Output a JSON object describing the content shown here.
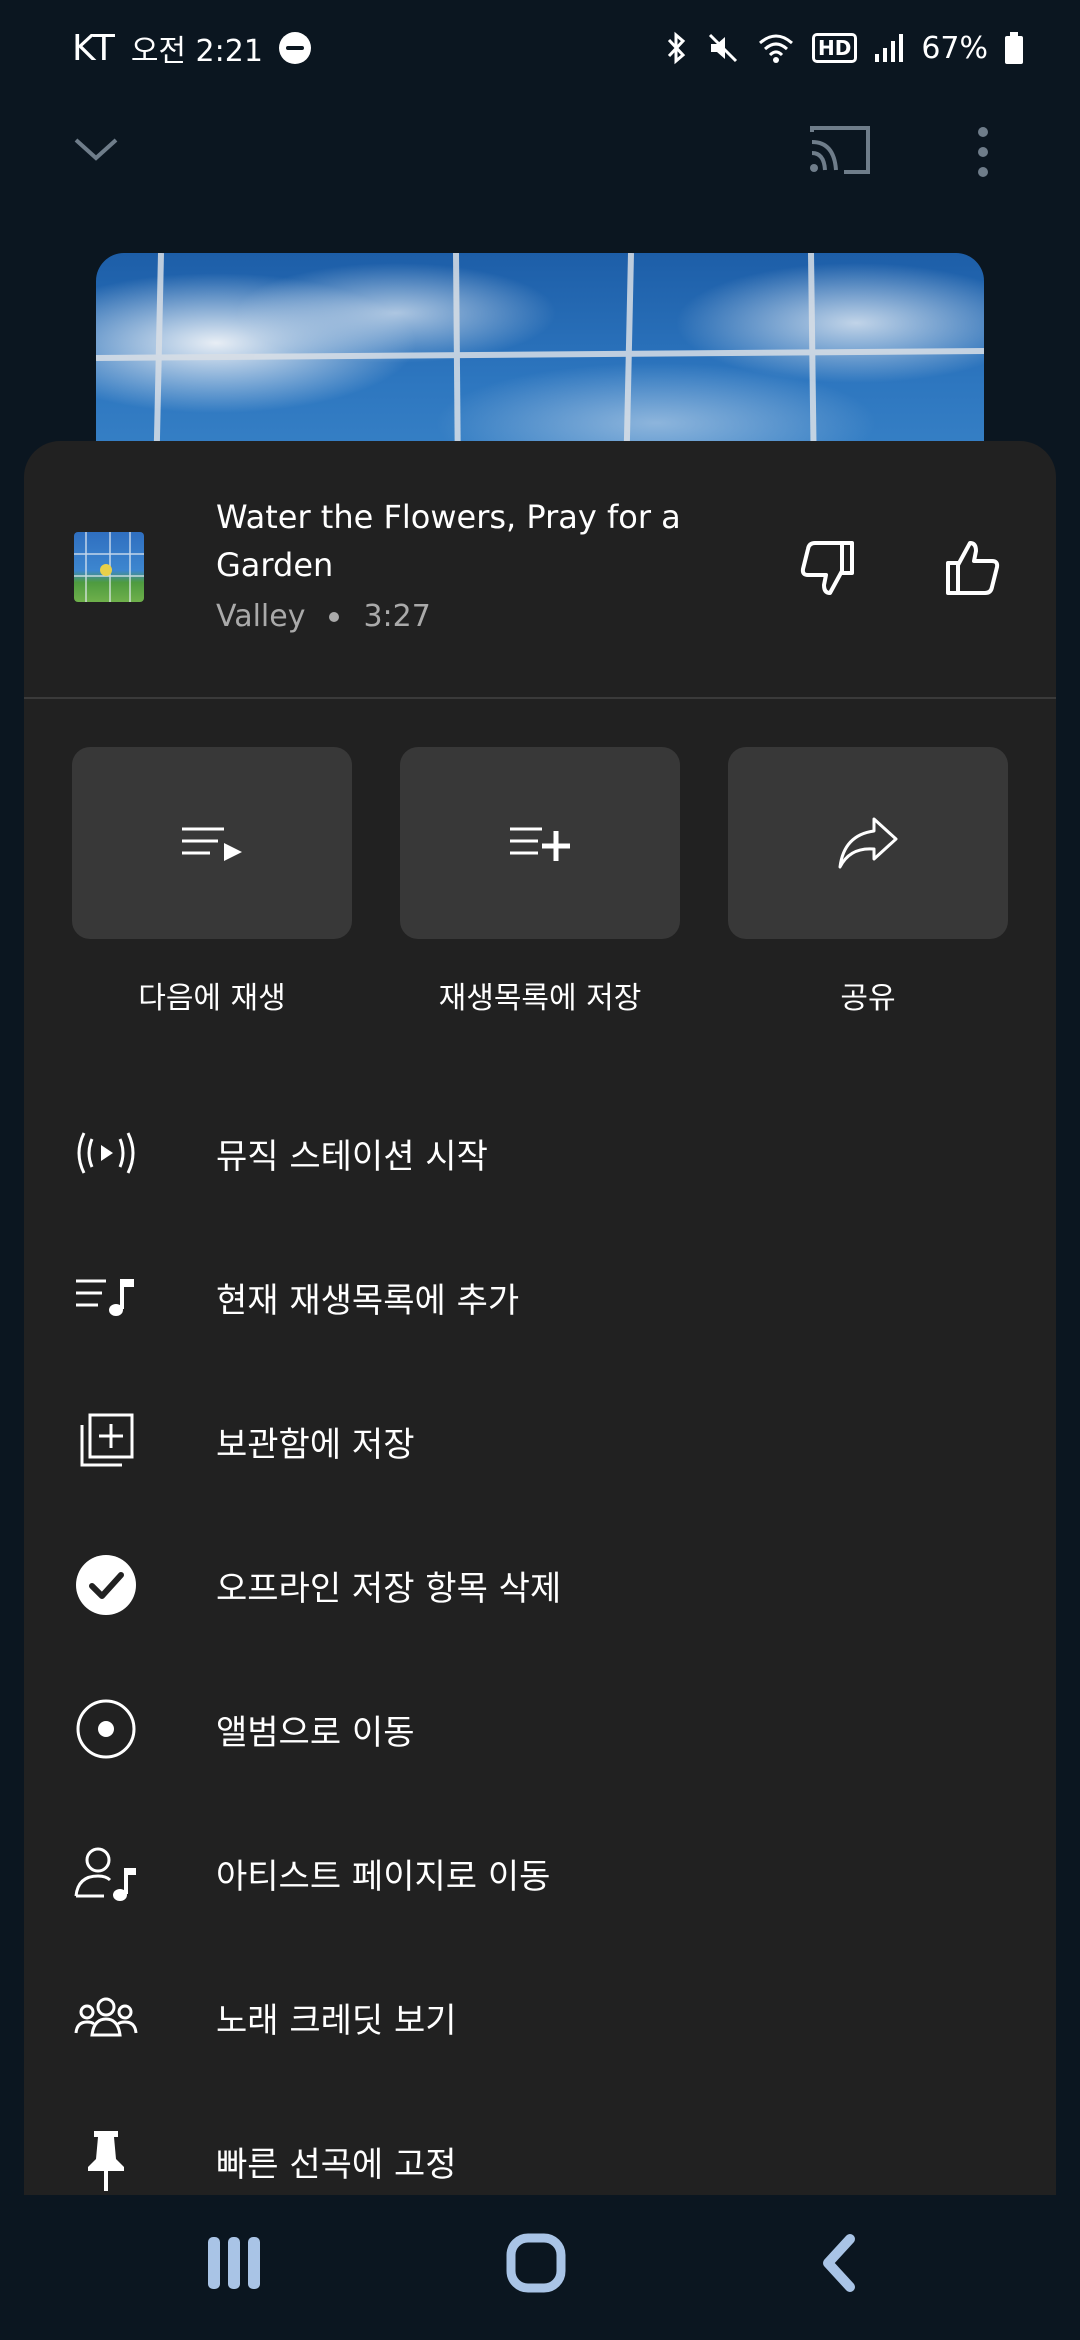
{
  "status_bar": {
    "carrier": "KT",
    "time": "오전 2:21",
    "hd": "HD",
    "battery": "67%"
  },
  "song": {
    "title": "Water the Flowers, Pray for a Garden",
    "artist": "Valley",
    "duration": "3:27"
  },
  "quick_actions": [
    {
      "label": "다음에 재생",
      "icon": "play-next-icon"
    },
    {
      "label": "재생목록에 저장",
      "icon": "add-to-playlist-icon"
    },
    {
      "label": "공유",
      "icon": "share-icon"
    }
  ],
  "menu_items": [
    {
      "label": "뮤직 스테이션 시작",
      "icon": "radio-icon"
    },
    {
      "label": "현재 재생목록에 추가",
      "icon": "queue-music-icon"
    },
    {
      "label": "보관함에 저장",
      "icon": "library-add-icon"
    },
    {
      "label": "오프라인 저장 항목 삭제",
      "icon": "downloaded-check-icon"
    },
    {
      "label": "앨범으로 이동",
      "icon": "album-icon"
    },
    {
      "label": "아티스트 페이지로 이동",
      "icon": "artist-icon"
    },
    {
      "label": "노래 크레딧 보기",
      "icon": "credits-icon"
    },
    {
      "label": "빠른 선곡에 고정",
      "icon": "pin-icon"
    }
  ],
  "colors": {
    "background": "#0b1620",
    "sheet": "#212121",
    "card": "#383838",
    "secondary_text": "#aaaaaa",
    "nav_icon": "#a9c4e6"
  }
}
